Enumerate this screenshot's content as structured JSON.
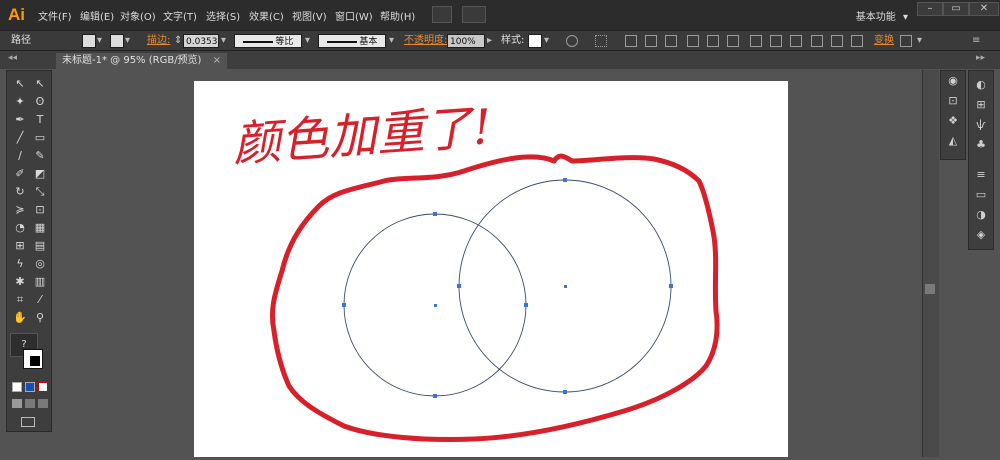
{
  "app": {
    "logo": "Ai"
  },
  "menu": [
    "文件(F)",
    "编辑(E)",
    "对象(O)",
    "文字(T)",
    "选择(S)",
    "效果(C)",
    "视图(V)",
    "窗口(W)",
    "帮助(H)"
  ],
  "workspace": {
    "label": "基本功能",
    "chevron": "▾"
  },
  "window_controls": {
    "minimize": "–",
    "restore": "▭",
    "close": "✕"
  },
  "control_bar": {
    "object_type": "路径",
    "stroke_label": "描边:",
    "stroke_weight": "0.0353",
    "profile": "等比",
    "brush": "基本",
    "opacity_label": "不透明度:",
    "opacity_value": "100%",
    "style_label": "样式:",
    "transform_label": "变换"
  },
  "document": {
    "tab_title": "未标题-1* @ 95% (RGB/预览)",
    "tab_close": "×"
  },
  "toolbar": {
    "help_glyph": "?"
  },
  "annotation": {
    "handwritten_text": "颜色加重了!",
    "annotation_color": "#d8202a"
  },
  "icons": [
    "collapse-left-icon",
    "selection-icon",
    "direct-selection-icon",
    "magic-wand-icon",
    "lasso-icon",
    "pen-icon",
    "type-icon",
    "line-icon",
    "rectangle-icon",
    "brush-icon",
    "pencil-icon",
    "rotate-icon",
    "scale-icon",
    "hand-icon",
    "zoom-icon",
    "color-icon",
    "layers-icon"
  ],
  "colors": {
    "menubar": "#2c2c2c",
    "ui_bg": "#535353",
    "accent_orange": "#e88a2e",
    "circle_stroke": "#3a4a66",
    "anchor_point": "#3b73d6"
  }
}
